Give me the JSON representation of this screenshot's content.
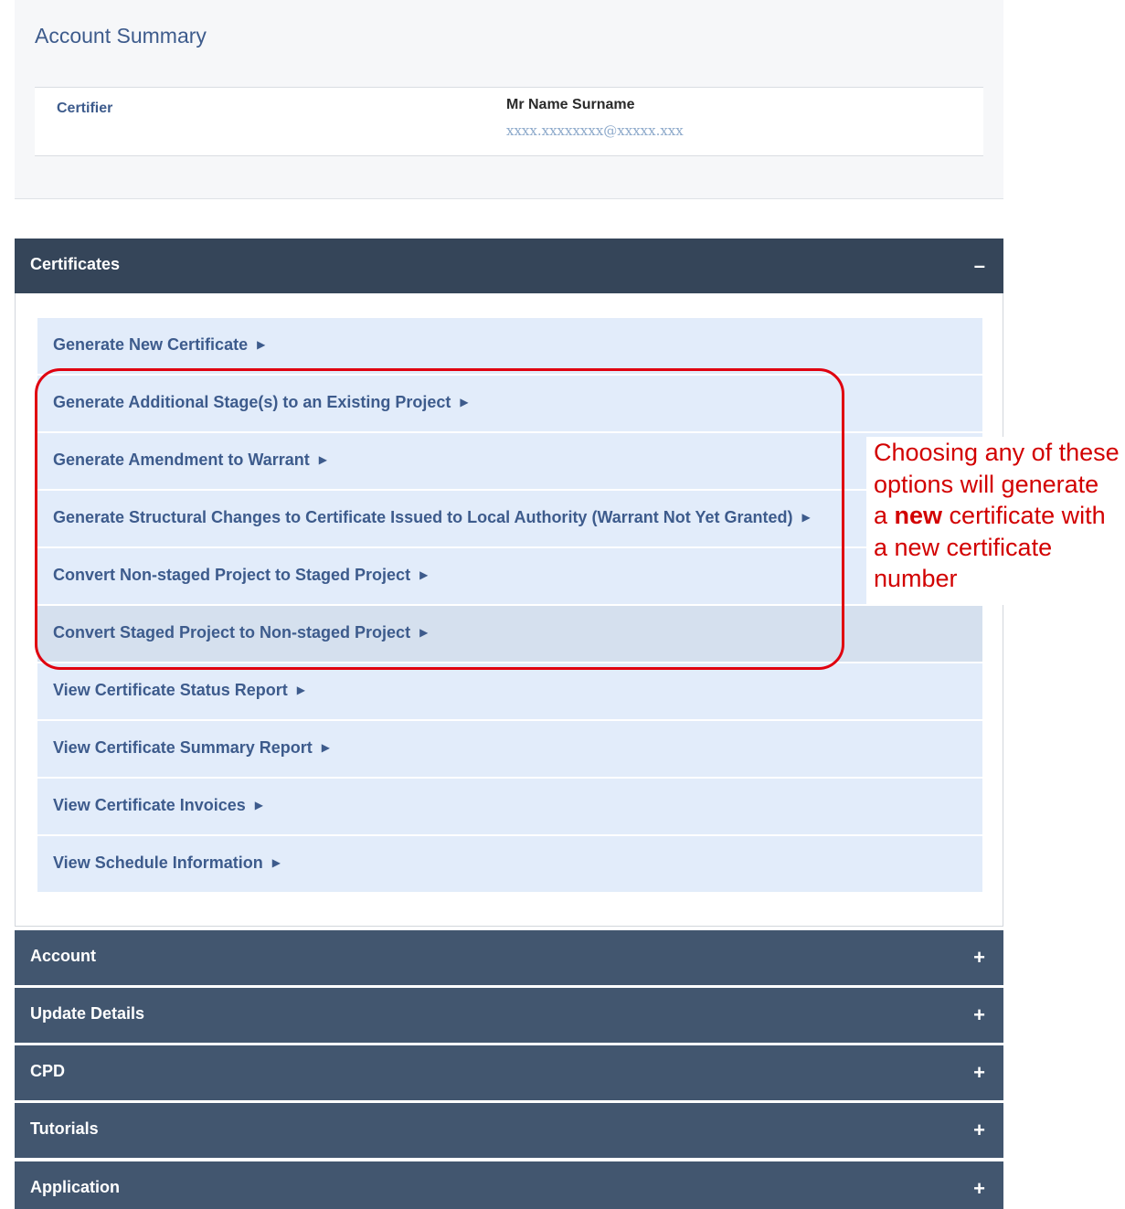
{
  "account_summary": {
    "title": "Account Summary",
    "label": "Certifier",
    "name": "Mr Name Surname",
    "email": "xxxx.xxxxxxxx@xxxxx.xxx"
  },
  "certificates": {
    "header": "Certificates",
    "toggle": "–",
    "items": [
      {
        "label": "Generate New Certificate"
      },
      {
        "label": "Generate Additional Stage(s) to an Existing Project"
      },
      {
        "label": "Generate Amendment to Warrant"
      },
      {
        "label": "Generate Structural Changes to Certificate Issued to Local Authority (Warrant Not Yet Granted)"
      },
      {
        "label": "Convert Non-staged Project to Staged Project"
      },
      {
        "label": "Convert Staged Project to Non-staged Project"
      },
      {
        "label": "View Certificate Status Report"
      },
      {
        "label": "View Certificate Summary Report"
      },
      {
        "label": "View Certificate Invoices"
      },
      {
        "label": "View Schedule Information"
      }
    ],
    "arrow": "▶"
  },
  "sections": [
    {
      "label": "Account",
      "toggle": "+"
    },
    {
      "label": "Update Details",
      "toggle": "+"
    },
    {
      "label": "CPD",
      "toggle": "+"
    },
    {
      "label": "Tutorials",
      "toggle": "+"
    },
    {
      "label": "Application",
      "toggle": "+"
    }
  ],
  "annotation": {
    "line1": "Choosing any of these",
    "line2": "options will generate",
    "line3_prefix": "a ",
    "line3_bold": "new",
    "line3_suffix": " certificate with",
    "line4": "a new certificate",
    "line5": "number"
  },
  "colors": {
    "header_bg": "#42566f",
    "header_active_bg": "#354559",
    "item_bg": "#e2ecfa",
    "link_text": "#3d5b8c",
    "annotation_red": "#e0000f"
  }
}
